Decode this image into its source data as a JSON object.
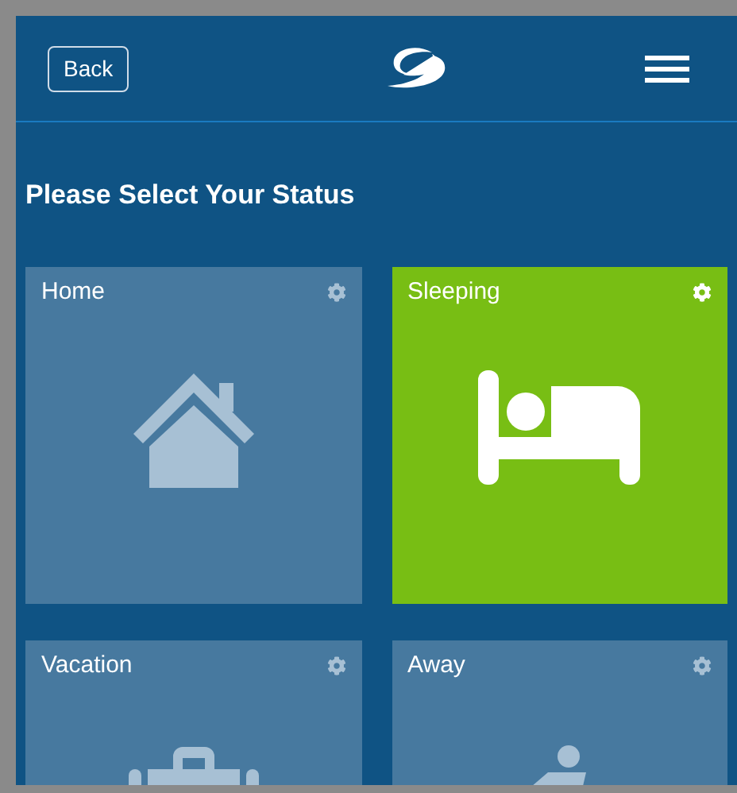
{
  "header": {
    "back_button": "Back"
  },
  "title": "Please Select Your Status",
  "statuses": [
    {
      "label": "Home",
      "kind": "home",
      "selected": false
    },
    {
      "label": "Sleeping",
      "kind": "sleeping",
      "selected": true
    },
    {
      "label": "Vacation",
      "kind": "vacation",
      "selected": false
    },
    {
      "label": "Away",
      "kind": "away",
      "selected": false
    }
  ]
}
